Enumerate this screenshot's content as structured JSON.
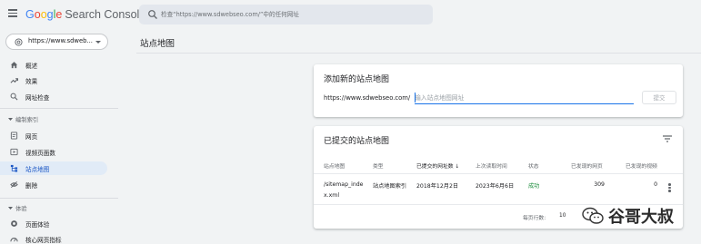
{
  "header": {
    "brand": {
      "g": "G",
      "o1": "o",
      "o2": "o",
      "g2": "g",
      "l": "l",
      "e": "e"
    },
    "product": "Search Console",
    "search_placeholder": "检查“https://www.sdwebseo.com/”中的任何网址"
  },
  "property": {
    "label": "https://www.sdweb..."
  },
  "sidebar": {
    "items_top": [
      {
        "label": "概述",
        "icon": "home-icon"
      },
      {
        "label": "效果",
        "icon": "trending-up-icon"
      },
      {
        "label": "网址检查",
        "icon": "search-icon"
      }
    ],
    "section_index": "编制索引",
    "items_index": [
      {
        "label": "网页",
        "icon": "page-icon"
      },
      {
        "label": "视频页面数",
        "icon": "video-page-icon"
      },
      {
        "label": "站点地图",
        "icon": "sitemap-icon"
      },
      {
        "label": "删除",
        "icon": "removal-icon"
      }
    ],
    "section_experience": "体验",
    "items_experience": [
      {
        "label": "页面体验",
        "icon": "page-experience-icon"
      },
      {
        "label": "核心网页指标",
        "icon": "core-web-vitals-icon"
      }
    ]
  },
  "main": {
    "title": "站点地图",
    "add_card": {
      "title": "添加新的站点地图",
      "prefix": "https://www.sdwebseo.com/",
      "input_placeholder": "输入站点地图网址",
      "submit": "提交"
    },
    "submitted_card": {
      "title": "已提交的站点地图",
      "columns": [
        "站点地图",
        "类型",
        "已提交的网址数",
        "上次读取时间",
        "状态",
        "已发现的网页",
        "已发现的视频"
      ],
      "sort_arrow": "↓",
      "row": {
        "sitemap_line1": "/sitemap_inde",
        "sitemap_line2": "x.xml",
        "type_line1": "站点地图索引",
        "type_line2": "",
        "submitted": "2018年12月2日",
        "last_read": "2023年6月6日",
        "status": "成功",
        "pages": "309",
        "videos": "0"
      },
      "footer": {
        "rows_per_page_label": "每页行数:",
        "rows_per_page_value": "10"
      }
    }
  },
  "watermark": {
    "text": "谷哥大叔"
  },
  "colors": {
    "accent": "#1a73e8",
    "active_bg": "#e1ebf7",
    "success": "#1e8e3e",
    "background": "#f1f3f4"
  }
}
